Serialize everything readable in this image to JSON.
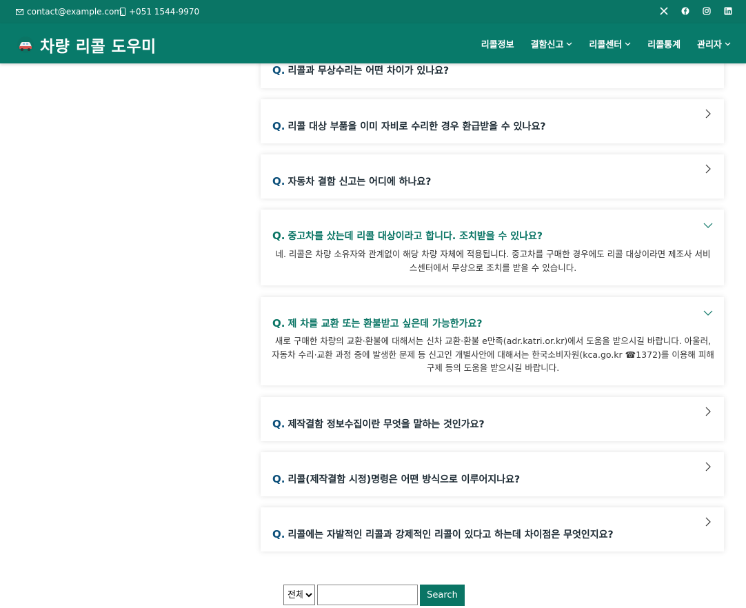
{
  "topbar": {
    "email": "contact@example.com",
    "phone": "+051 1544-9970",
    "socials": [
      "x-icon",
      "facebook-icon",
      "instagram-icon",
      "linkedin-icon"
    ]
  },
  "header": {
    "title": "차량 리콜 도우미",
    "nav": [
      {
        "label": "리콜정보",
        "dropdown": false
      },
      {
        "label": "결함신고",
        "dropdown": true
      },
      {
        "label": "리콜센터",
        "dropdown": true
      },
      {
        "label": "리콜통계",
        "dropdown": false
      },
      {
        "label": "관리자",
        "dropdown": true
      }
    ]
  },
  "faq": [
    {
      "q": "Q.",
      "text": "리콜과 무상수리는 어떤 차이가 있나요?",
      "open": false,
      "answer": ""
    },
    {
      "q": "Q.",
      "text": "리콜 대상 부품을 이미 자비로 수리한 경우 환급받을 수 있나요?",
      "open": false,
      "answer": ""
    },
    {
      "q": "Q.",
      "text": "자동차 결함 신고는 어디에 하나요?",
      "open": false,
      "answer": ""
    },
    {
      "q": "Q.",
      "text": "중고차를 샀는데 리콜 대상이라고 합니다. 조치받을 수 있나요?",
      "open": true,
      "answer": "네. 리콜은 차량 소유자와 관계없이 해당 차량 자체에 적용됩니다. 중고차를 구매한 경우에도 리콜 대상이라면 제조사 서비스센터에서 무상으로 조치를 받을 수 있습니다."
    },
    {
      "q": "Q.",
      "text": "제 차를 교환 또는 환불받고 싶은데 가능한가요?",
      "open": true,
      "answer": "새로 구매한 차량의 교환·환불에 대해서는 신차 교환·환불 e만족(adr.katri.or.kr)에서 도움을 받으시길 바랍니다. 아울러, 자동차 수리·교환 과정 중에 발생한 문제 등 신고인 개별사안에 대해서는 한국소비자원(kca.go.kr ☎1372)를 이용해 피해구제 등의 도움을 받으시길 바랍니다."
    },
    {
      "q": "Q.",
      "text": "제작결함 정보수집이란 무엇을 말하는 것인가요?",
      "open": false,
      "answer": ""
    },
    {
      "q": "Q.",
      "text": "리콜(제작결함 시정)명령은 어떤 방식으로 이루어지나요?",
      "open": false,
      "answer": ""
    },
    {
      "q": "Q.",
      "text": "리콜에는 자발적인 리콜과 강제적인 리콜이 있다고 하는데 차이점은 무엇인지요?",
      "open": false,
      "answer": ""
    }
  ],
  "search": {
    "select_value": "전체",
    "input_value": "",
    "button_label": "Search"
  },
  "colors": {
    "brand": "#0a7565",
    "question_mark": "#0b4f7a"
  }
}
